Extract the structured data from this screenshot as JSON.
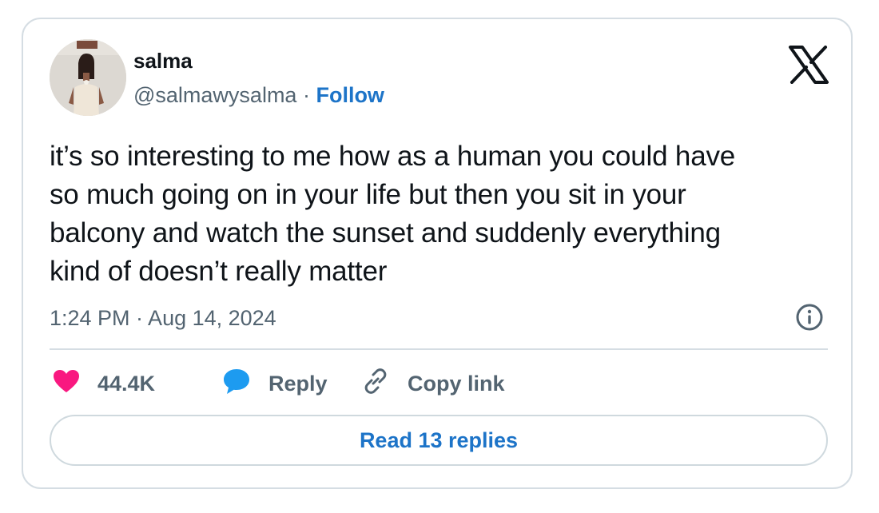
{
  "author": {
    "name": "salma",
    "handle": "@salmawysalma",
    "separator": " · ",
    "follow_label": "Follow"
  },
  "tweet": {
    "text": "it’s so interesting to me how as a human you could have\nso much going on in your life but then you sit in your\nbalcony and watch the sunset and suddenly everything\nkind of doesn’t really matter",
    "timestamp": "1:24 PM · Aug 14, 2024"
  },
  "actions": {
    "likes_count": "44.4K",
    "reply_label": "Reply",
    "copy_link_label": "Copy link"
  },
  "read_replies_label": "Read 13 replies",
  "icons": {
    "logo": "x-logo-icon",
    "info": "info-icon",
    "like": "heart-icon",
    "reply": "speech-bubble-icon",
    "copy": "link-icon"
  },
  "colors": {
    "accent": "#1d74c8",
    "like": "#f91880",
    "reply": "#1d9bf0",
    "muted_text": "#536471",
    "border": "#d5dde3"
  }
}
